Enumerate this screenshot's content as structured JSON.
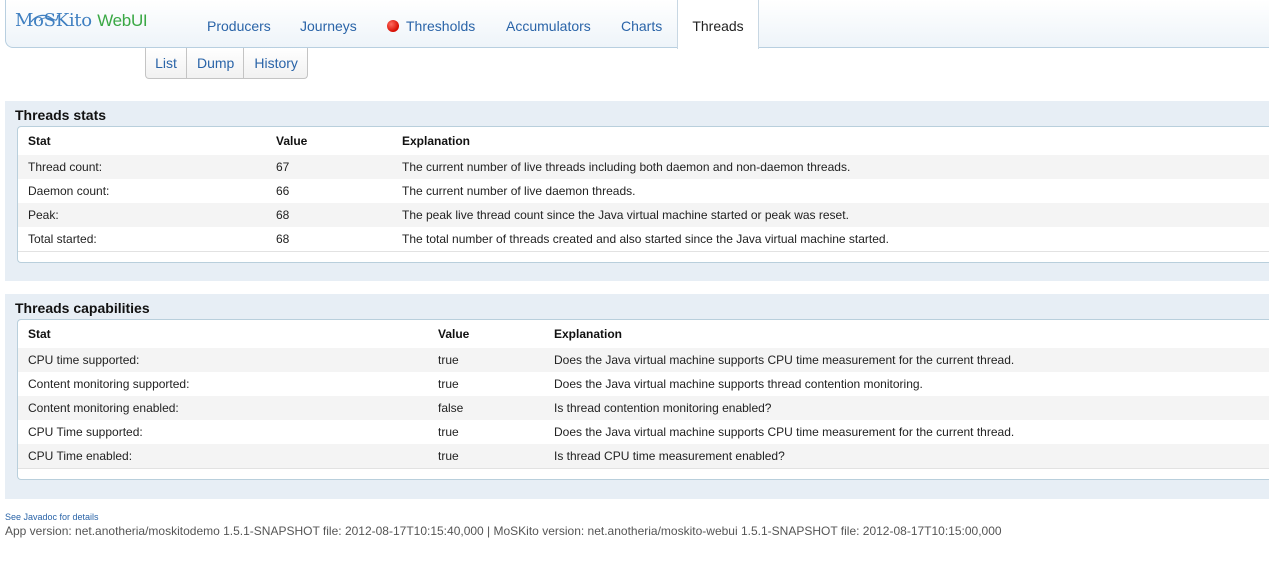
{
  "app": {
    "logo_main": "MoSKito",
    "logo_suffix": "WebUI"
  },
  "nav": {
    "items": [
      {
        "label": "Producers"
      },
      {
        "label": "Journeys"
      },
      {
        "label": "Thresholds"
      },
      {
        "label": "Accumulators"
      },
      {
        "label": "Charts"
      }
    ],
    "active": "Threads",
    "threshold_dot_color": "#e01a0e"
  },
  "subnav": {
    "items": [
      {
        "label": "List"
      },
      {
        "label": "Dump"
      },
      {
        "label": "History"
      }
    ]
  },
  "threads_stats": {
    "title": "Threads stats",
    "columns": [
      "Stat",
      "Value",
      "Explanation"
    ],
    "rows": [
      [
        "Thread count:",
        "67",
        "The current number of live threads including both daemon and non-daemon threads."
      ],
      [
        "Daemon count:",
        "66",
        "The current number of live daemon threads."
      ],
      [
        "Peak:",
        "68",
        "The peak live thread count since the Java virtual machine started or peak was reset."
      ],
      [
        "Total started:",
        "68",
        "The total number of threads created and also started since the Java virtual machine started."
      ]
    ]
  },
  "threads_capabilities": {
    "title": "Threads capabilities",
    "columns": [
      "Stat",
      "Value",
      "Explanation"
    ],
    "rows": [
      [
        "CPU time supported:",
        "true",
        "Does the Java virtual machine supports CPU time measurement for the current thread."
      ],
      [
        "Content monitoring supported:",
        "true",
        "Does the Java virtual machine supports thread contention monitoring."
      ],
      [
        "Content monitoring enabled:",
        "false",
        "Is thread contention monitoring enabled?"
      ],
      [
        "CPU Time supported:",
        "true",
        "Does the Java virtual machine supports CPU time measurement for the current thread."
      ],
      [
        "CPU Time enabled:",
        "true",
        "Is thread CPU time measurement enabled?"
      ]
    ]
  },
  "footer": {
    "javadoc_link": "See Javadoc for details",
    "version": "App version: net.anotheria/moskitodemo 1.5.1-SNAPSHOT file: 2012-08-17T10:15:40,000  |  MoSKito version: net.anotheria/moskito-webui 1.5.1-SNAPSHOT file: 2012-08-17T10:15:00,000"
  }
}
